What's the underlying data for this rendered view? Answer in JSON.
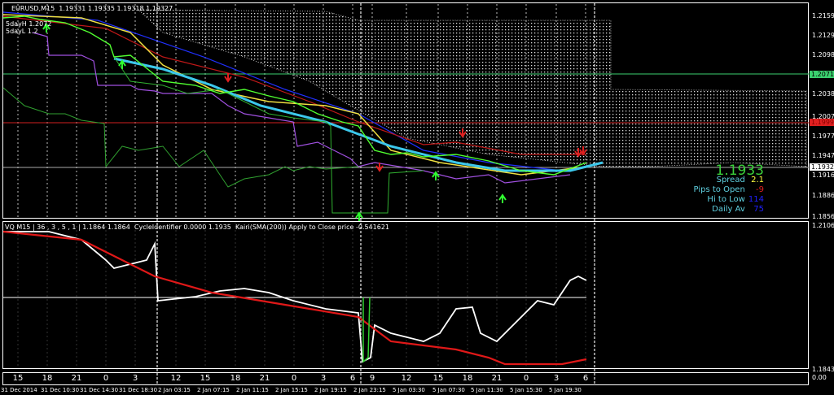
{
  "header": {
    "symbol": "EURUSD,M15",
    "ohlc": "1.19331 1.19335 1.19318 1.19327",
    "day_high": "5dayH 1.2072",
    "day_low": "5dayL 1.2"
  },
  "price_axis": [
    "1.21590",
    "1.21290",
    "1.20985",
    "1.20380",
    "1.20075",
    "1.19775",
    "1.19470",
    "1.19165",
    "1.18865",
    "1.18560"
  ],
  "price_tags": {
    "green": "1.20716",
    "red": "1.19997",
    "current": "1.19327"
  },
  "info": {
    "price": "1.1933",
    "spread_label": "Spread",
    "spread": "2.1",
    "pips_label": "Pips to Open",
    "pips": "-9",
    "hilo_label": "Hi to Low",
    "hilo": "114",
    "daily_label": "Daily Av",
    "daily": "75"
  },
  "sub": {
    "header": "VQ M15 | 36 , 3 , 5 , 1 | 1.1864 1.1864  CycleIdentifier 0.0000 1.1935  Kairi(SMA(200)) Apply to Close price -0.541621",
    "axis_top": "1.2106",
    "axis_bottom": "1.1843",
    "hours_axis": "0.00"
  },
  "hours": [
    "15",
    "18",
    "21",
    "0",
    "3",
    "12",
    "15",
    "18",
    "21",
    "0",
    "3",
    "6",
    "9",
    "12",
    "15",
    "18",
    "21",
    "0",
    "3",
    "6"
  ],
  "dates": [
    "31 Dec 2014",
    "31 Dec 10:30",
    "31 Dec 14:30",
    "31 Dec 18:30",
    "2 Jan 03:15",
    "2 Jan 07:15",
    "2 Jan 11:15",
    "2 Jan 15:15",
    "2 Jan 19:15",
    "2 Jan 23:15",
    "5 Jan 03:30",
    "5 Jan 07:30",
    "5 Jan 11:30",
    "5 Jan 15:30",
    "5 Jan 19:30"
  ],
  "colors": {
    "green": "#3bd16f",
    "red": "#e02020",
    "bg": "#000000"
  }
}
